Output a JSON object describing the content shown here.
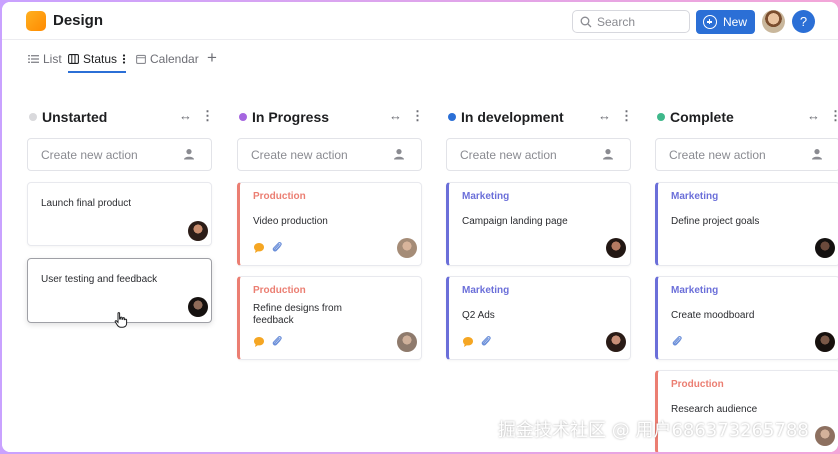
{
  "app": {
    "title": "Design"
  },
  "header": {
    "search_placeholder": "Search",
    "new_label": "New",
    "help_label": "?"
  },
  "tabs": [
    {
      "label": "List",
      "icon": "list-icon"
    },
    {
      "label": "Status",
      "icon": "board-icon"
    },
    {
      "label": "Calendar",
      "icon": "calendar-icon"
    }
  ],
  "colors": {
    "accent": "#2b6fd6",
    "production": "#eb7e72",
    "marketing": "#6b6fd9",
    "unstarted": "#d9d9dc",
    "in_progress": "#a566e0",
    "in_development": "#2b6fd6",
    "complete": "#3fb88b"
  },
  "columns": [
    {
      "title": "Unstarted",
      "create_placeholder": "Create new action",
      "cards": [
        {
          "title": "Launch final product"
        },
        {
          "title": "User testing and feedback"
        }
      ]
    },
    {
      "title": "In Progress",
      "create_placeholder": "Create new action",
      "cards": [
        {
          "tag": "Production",
          "title": "Video production"
        },
        {
          "tag": "Production",
          "title": "Refine designs from feedback"
        }
      ]
    },
    {
      "title": "In development",
      "create_placeholder": "Create new action",
      "cards": [
        {
          "tag": "Marketing",
          "title": "Campaign landing page"
        },
        {
          "tag": "Marketing",
          "title": "Q2 Ads"
        }
      ]
    },
    {
      "title": "Complete",
      "create_placeholder": "Create new action",
      "cards": [
        {
          "tag": "Marketing",
          "title": "Define project goals"
        },
        {
          "tag": "Marketing",
          "title": "Create moodboard"
        },
        {
          "tag": "Production",
          "title": "Research audience"
        }
      ]
    }
  ],
  "watermark": "掘金技术社区 @ 用户686373265788"
}
